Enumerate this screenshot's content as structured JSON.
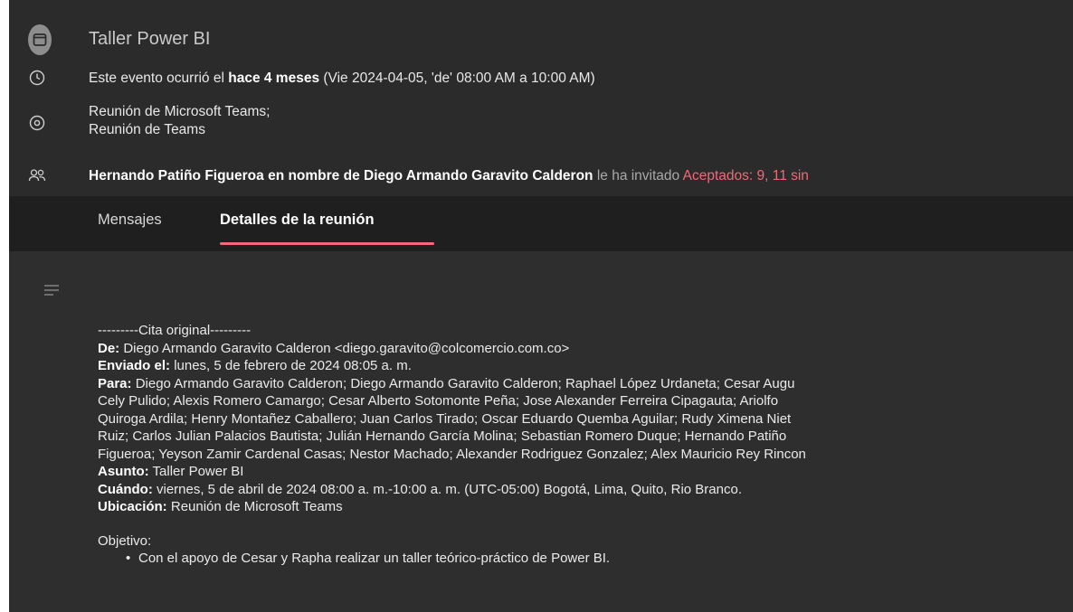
{
  "event": {
    "title": "Taller Power BI",
    "time": {
      "prefix": "Este evento ocurrió el ",
      "relative": "hace 4 meses",
      "detail": " (Vie 2024-04-05, 'de' 08:00 AM a 10:00 AM)"
    },
    "location": {
      "line1": "Reunión de Microsoft Teams;",
      "line2": "Reunión de Teams"
    },
    "invite": {
      "organizer": "Hernando Patiño Figueroa en nombre de Diego Armando Garavito Calderon",
      "action": " le ha invitado ",
      "status": "Aceptados: 9, 11 sin"
    }
  },
  "tabs": [
    {
      "label": "Mensajes",
      "active": false
    },
    {
      "label": "Detalles de la reunión",
      "active": true
    }
  ],
  "details": {
    "separator": "---------Cita original---------",
    "from_label": "De:",
    "from_value": " Diego Armando Garavito Calderon <diego.garavito@colcomercio.com.co>",
    "sent_label": "Enviado el:",
    "sent_value": " lunes, 5 de febrero de 2024 08:05 a. m.",
    "to_label": "Para:",
    "to_lines": [
      " Diego Armando Garavito Calderon; Diego Armando Garavito Calderon; Raphael López Urdaneta; Cesar Augu",
      "Cely Pulido; Alexis Romero Camargo; Cesar Alberto Sotomonte Peña; Jose Alexander Ferreira Cipagauta; Ariolfo",
      "Quiroga Ardila; Henry Montañez Caballero; Juan Carlos Tirado; Oscar Eduardo Quemba Aguilar; Rudy Ximena Niet",
      "Ruiz; Carlos Julian Palacios Bautista; Julián Hernando García Molina; Sebastian Romero Duque; Hernando Patiño",
      "Figueroa; Yeyson Zamir Cardenal Casas; Nestor Machado; Alexander Rodriguez Gonzalez; Alex Mauricio Rey Rincon"
    ],
    "subject_label": "Asunto:",
    "subject_value": " Taller Power BI",
    "when_label": "Cuándo:",
    "when_value": " viernes, 5 de abril de 2024 08:00 a. m.-10:00 a. m. (UTC-05:00) Bogotá, Lima, Quito, Rio Branco.",
    "location_label": "Ubicación:",
    "location_value": " Reunión de Microsoft Teams",
    "objective_label": "Objetivo:",
    "objective_bullet": "Con el apoyo de Cesar y Rapha realizar un taller teórico-práctico de Power BI."
  },
  "icons": [
    "calendar-icon",
    "clock-icon",
    "location-icon",
    "people-icon",
    "description-lines-icon"
  ],
  "colors": {
    "accent": "#f06a78",
    "header_bg": "#2b2b2b",
    "tabs_bg": "#1f1f1f",
    "content_bg": "#2e2e2e"
  }
}
